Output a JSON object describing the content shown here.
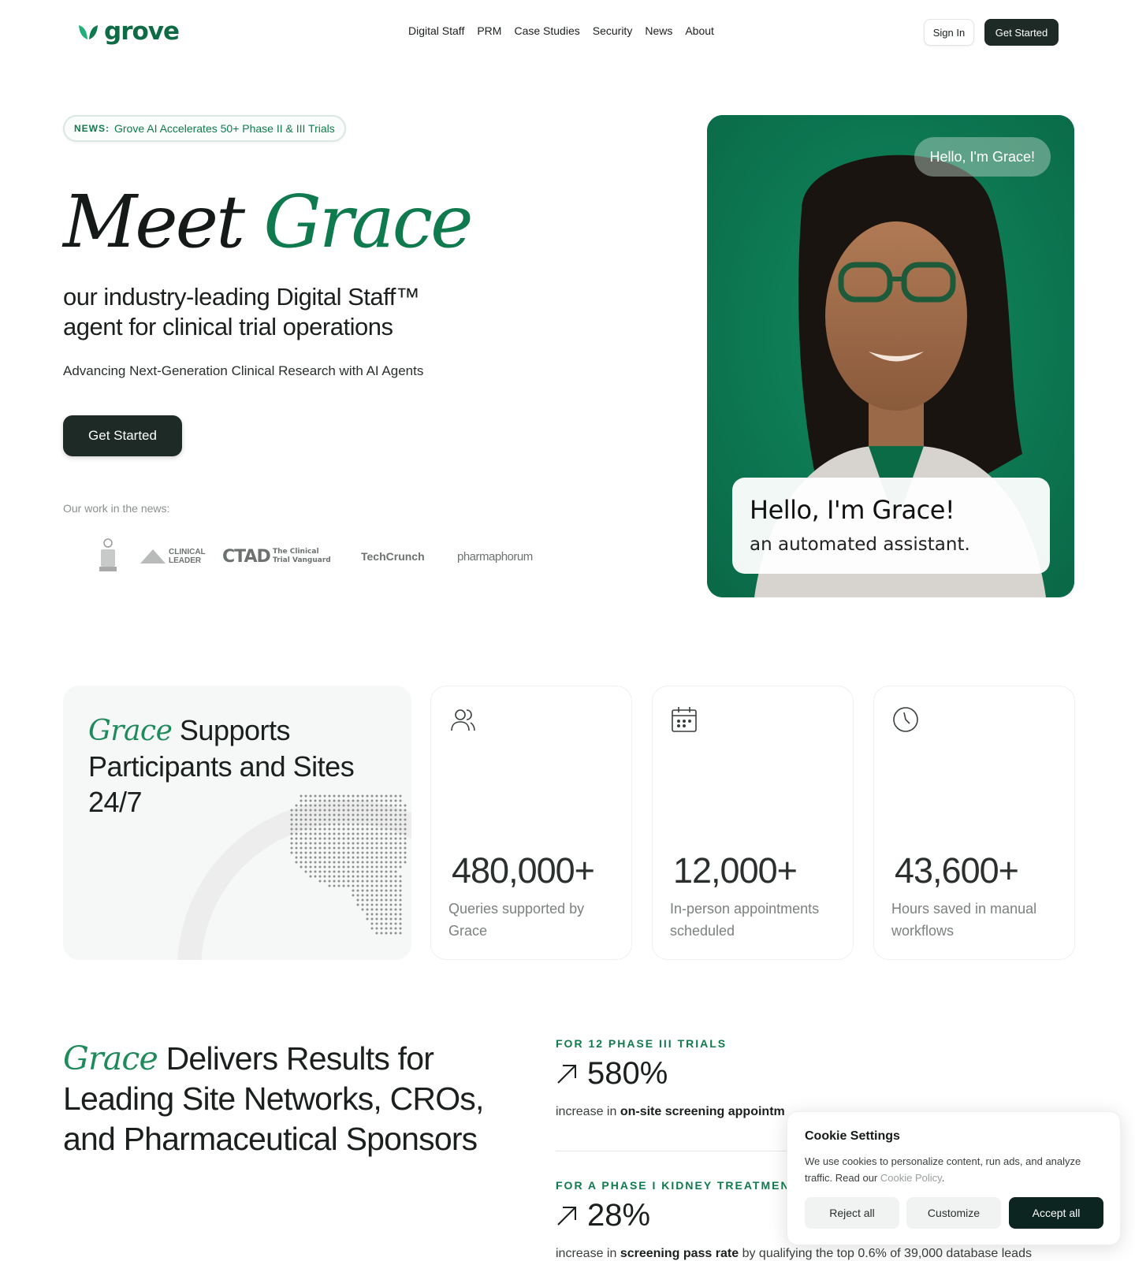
{
  "brand": {
    "name": "grove",
    "color": "#0f6b45"
  },
  "nav": {
    "links": [
      "Digital Staff",
      "PRM",
      "Case Studies",
      "Security",
      "News",
      "About"
    ],
    "sign_in": "Sign In",
    "get_started": "Get Started"
  },
  "hero": {
    "news_tag": "NEWS:",
    "news_text": "Grove AI Accelerates 50+ Phase II & III Trials",
    "title_a": "Meet",
    "title_b": "Grace",
    "subtitle": "our industry-leading Digital Staff™ agent for clinical trial operations",
    "tagline": "Advancing Next-Generation Clinical Research with AI Agents",
    "cta": "Get Started",
    "press_label": "Our work in the news:",
    "press": {
      "clinical_leader": [
        "CLINICAL",
        "LEADER"
      ],
      "ctad": "CTAD",
      "tcv": [
        "The Clinical",
        "Trial Vanguard"
      ],
      "techcrunch": "TechCrunch",
      "pharmaphorum": "pharmaphorum"
    }
  },
  "video": {
    "greeting_pill": "Hello, I'm Grace!",
    "caption_line1": "Hello, I'm Grace!",
    "caption_line2": "an automated assistant."
  },
  "support": {
    "script_word": "Grace",
    "title_rest": "Supports Participants and Sites 24/7"
  },
  "stats": [
    {
      "icon": "users-icon",
      "value": "480,000+",
      "label": "Queries supported by Grace"
    },
    {
      "icon": "calendar-icon",
      "value": "12,000+",
      "label": "In-person appointments scheduled"
    },
    {
      "icon": "clock-icon",
      "value": "43,600+",
      "label": "Hours saved in manual workflows"
    }
  ],
  "results": {
    "script_word": "Grace",
    "title_rest": "Delivers Results for Leading Site Networks, CROs, and Pharmaceutical Sponsors",
    "items": [
      {
        "caption": "FOR 12 PHASE III TRIALS",
        "value": "580%",
        "desc_pre": "increase in",
        "desc_bold": "on-site screening appointm",
        "desc_post": ""
      },
      {
        "caption": "FOR A PHASE I KIDNEY TREATMENT",
        "value": "28%",
        "desc_pre": "increase in",
        "desc_bold": "screening pass rate",
        "desc_post": "by qualifying the top 0.6% of 39,000 database leads"
      }
    ]
  },
  "cookie": {
    "title": "Cookie Settings",
    "text": "We use cookies to personalize content, run ads, and analyze traffic. Read our",
    "link": "Cookie Policy",
    "reject": "Reject all",
    "customize": "Customize",
    "accept": "Accept all"
  },
  "colors": {
    "accent": "#0f7a4e",
    "dark_button": "#1d2a26",
    "video_bg": "#0d7a55"
  }
}
